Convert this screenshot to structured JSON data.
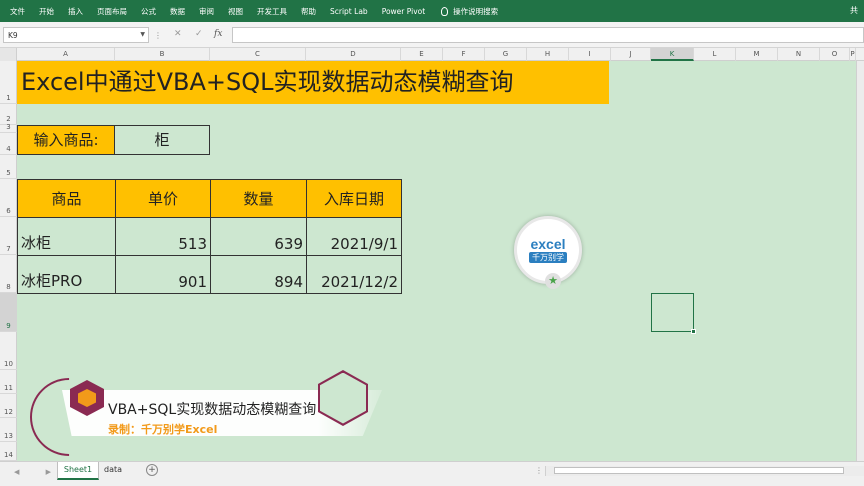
{
  "ribbon": {
    "tabs": [
      "文件",
      "开始",
      "插入",
      "页面布局",
      "公式",
      "数据",
      "审阅",
      "视图",
      "开发工具",
      "帮助",
      "Script Lab",
      "Power Pivot"
    ],
    "search_label": "操作说明搜索",
    "right_text": "共"
  },
  "formula_bar": {
    "name_box": "K9",
    "fx_label": "fx",
    "cancel_symbol": "✕",
    "enter_symbol": "✓",
    "formula": ""
  },
  "columns": [
    "A",
    "B",
    "C",
    "D",
    "E",
    "F",
    "G",
    "H",
    "I",
    "J",
    "K",
    "L",
    "M",
    "N",
    "O",
    "P"
  ],
  "rows": [
    "1",
    "2",
    "3",
    "4",
    "5",
    "6",
    "7",
    "8",
    "9",
    "10",
    "11",
    "12",
    "13",
    "14"
  ],
  "sheet": {
    "title": "Excel中通过VBA+SQL实现数据动态模糊查询",
    "input_label": "输入商品:",
    "input_value": "柜",
    "table": {
      "headers": [
        "商品",
        "单价",
        "数量",
        "入库日期"
      ],
      "rows": [
        [
          "冰柜",
          "513",
          "639",
          "2021/9/1"
        ],
        [
          "冰柜PRO",
          "901",
          "894",
          "2021/12/2"
        ]
      ]
    }
  },
  "badge": {
    "top": "excel",
    "bottom": "千万别学"
  },
  "sheet_tabs": [
    "Sheet1",
    "data"
  ],
  "overlay": {
    "title": "VBA+SQL实现数据动态模糊查询",
    "subtitle": "录制：千万别学Excel"
  },
  "colors": {
    "ribbon": "#217346",
    "header_fill": "#ffc000",
    "grid_bg": "#cde7d0",
    "accent": "#8a2a52",
    "orange": "#f29a1a"
  }
}
